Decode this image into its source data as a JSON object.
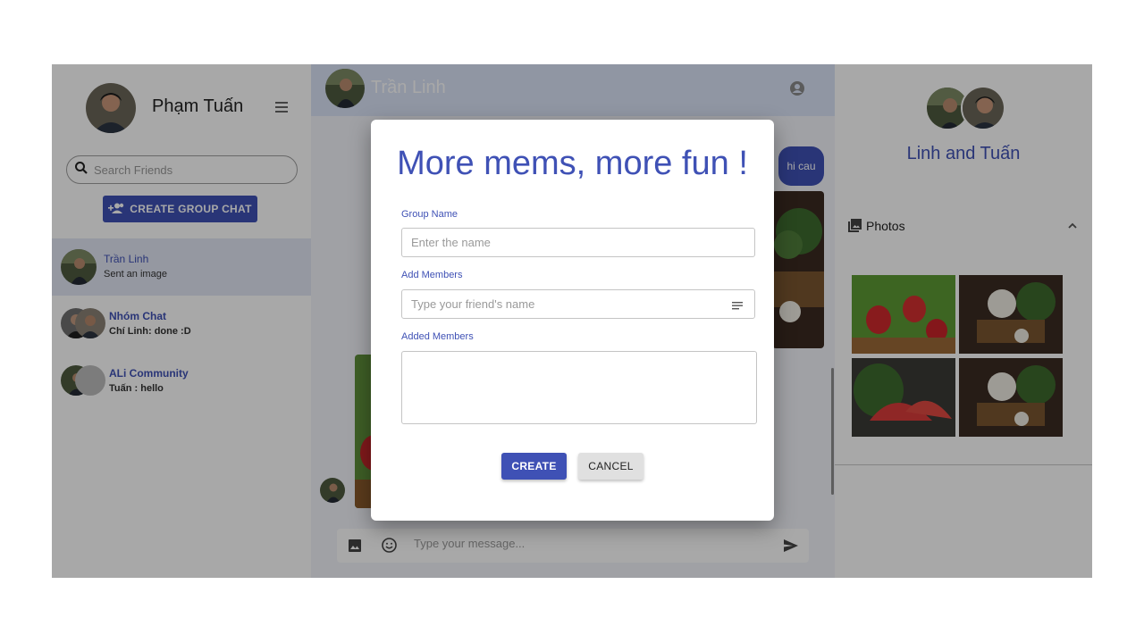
{
  "profile": {
    "name": "Phạm Tuấn"
  },
  "search": {
    "placeholder": "Search Friends"
  },
  "actions": {
    "create_group_label": "CREATE GROUP CHAT"
  },
  "chats": [
    {
      "name": "Trần Linh",
      "last_message": "Sent an image"
    },
    {
      "name": "Nhóm Chat",
      "last_message": "Chí Linh: done :D"
    },
    {
      "name": "ALi Community",
      "last_message": "Tuấn : hello"
    }
  ],
  "conversation": {
    "title": "Trần Linh",
    "bubble_text": "hi cau",
    "composer_placeholder": "Type your message..."
  },
  "info_panel": {
    "title": "Linh and Tuấn",
    "photos_label": "Photos"
  },
  "modal": {
    "title": "More mems, more fun !",
    "group_name_label": "Group Name",
    "group_name_placeholder": "Enter the name",
    "add_members_label": "Add Members",
    "add_members_placeholder": "Type your friend's name",
    "added_members_label": "Added Members",
    "create_label": "CREATE",
    "cancel_label": "CANCEL"
  },
  "colors": {
    "primary": "#3f51b5",
    "header_bg": "#dbe4f7",
    "active_chat_bg": "#e3e7f5"
  },
  "icons": [
    "menu-icon",
    "search-icon",
    "group-add-icon",
    "account-circle-icon",
    "image-icon",
    "emoji-icon",
    "send-icon",
    "photo-library-icon",
    "chevron-up-icon",
    "list-icon"
  ]
}
